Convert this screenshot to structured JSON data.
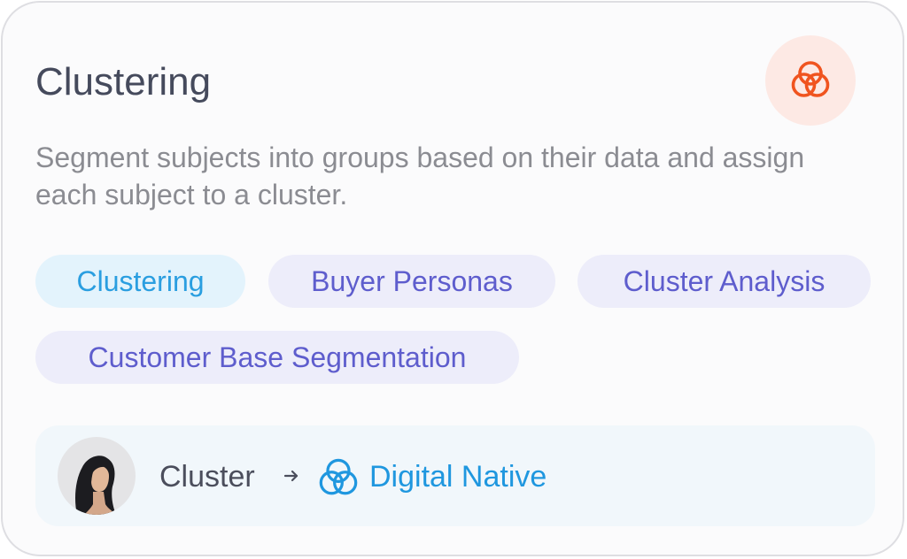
{
  "card": {
    "title": "Clustering",
    "description": "Segment subjects into groups based on their data and assign each subject to a cluster.",
    "badge_icon": "venn-three-circles-icon",
    "badge_icon_color": "#f0541f",
    "badge_background": "#fde9e4"
  },
  "tags": [
    {
      "label": "Clustering",
      "active": true
    },
    {
      "label": "Buyer Personas",
      "active": false
    },
    {
      "label": "Cluster Analysis",
      "active": false
    },
    {
      "label": "Customer Base Segmentation",
      "active": false
    }
  ],
  "footer": {
    "avatar": "user-avatar-woman",
    "label": "Cluster",
    "arrow_icon": "arrow-right-icon",
    "value_icon": "venn-three-circles-icon",
    "value": "Digital Native",
    "value_color": "#1f97df"
  }
}
